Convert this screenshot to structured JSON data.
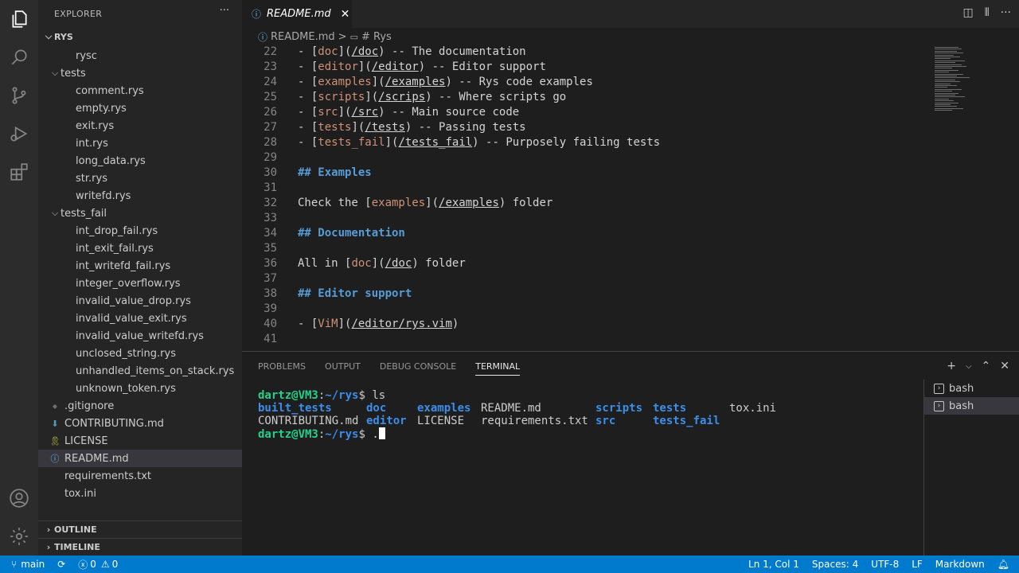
{
  "explorer": {
    "title": "EXPLORER",
    "more": "···",
    "root": "RYS",
    "rows": [
      {
        "label": "rysc",
        "indent": 2,
        "kind": "file",
        "icon": "file"
      },
      {
        "label": "tests",
        "indent": 1,
        "kind": "folder",
        "icon": "folder"
      },
      {
        "label": "comment.rys",
        "indent": 2,
        "kind": "file",
        "icon": "file"
      },
      {
        "label": "empty.rys",
        "indent": 2,
        "kind": "file",
        "icon": "file"
      },
      {
        "label": "exit.rys",
        "indent": 2,
        "kind": "file",
        "icon": "file"
      },
      {
        "label": "int.rys",
        "indent": 2,
        "kind": "file",
        "icon": "file"
      },
      {
        "label": "long_data.rys",
        "indent": 2,
        "kind": "file",
        "icon": "file"
      },
      {
        "label": "str.rys",
        "indent": 2,
        "kind": "file",
        "icon": "file"
      },
      {
        "label": "writefd.rys",
        "indent": 2,
        "kind": "file",
        "icon": "file"
      },
      {
        "label": "tests_fail",
        "indent": 1,
        "kind": "folder",
        "icon": "folder"
      },
      {
        "label": "int_drop_fail.rys",
        "indent": 2,
        "kind": "file",
        "icon": "file"
      },
      {
        "label": "int_exit_fail.rys",
        "indent": 2,
        "kind": "file",
        "icon": "file"
      },
      {
        "label": "int_writefd_fail.rys",
        "indent": 2,
        "kind": "file",
        "icon": "file"
      },
      {
        "label": "integer_overflow.rys",
        "indent": 2,
        "kind": "file",
        "icon": "file"
      },
      {
        "label": "invalid_value_drop.rys",
        "indent": 2,
        "kind": "file",
        "icon": "file"
      },
      {
        "label": "invalid_value_exit.rys",
        "indent": 2,
        "kind": "file",
        "icon": "file"
      },
      {
        "label": "invalid_value_writefd.rys",
        "indent": 2,
        "kind": "file",
        "icon": "file"
      },
      {
        "label": "unclosed_string.rys",
        "indent": 2,
        "kind": "file",
        "icon": "file"
      },
      {
        "label": "unhandled_items_on_stack.rys",
        "indent": 2,
        "kind": "file",
        "icon": "file"
      },
      {
        "label": "unknown_token.rys",
        "indent": 2,
        "kind": "file",
        "icon": "file"
      },
      {
        "label": ".gitignore",
        "indent": 1,
        "kind": "file",
        "icon": "gitignore-icon"
      },
      {
        "label": "CONTRIBUTING.md",
        "indent": 1,
        "kind": "file",
        "icon": "markdown-down-arrow-icon"
      },
      {
        "label": "LICENSE",
        "indent": 1,
        "kind": "file",
        "icon": "license-ribbon-icon"
      },
      {
        "label": "README.md",
        "indent": 1,
        "kind": "file",
        "icon": "info-icon",
        "selected": true
      },
      {
        "label": "requirements.txt",
        "indent": 1,
        "kind": "file",
        "icon": "file"
      },
      {
        "label": "tox.ini",
        "indent": 1,
        "kind": "file",
        "icon": "file"
      }
    ],
    "outline": "OUTLINE",
    "timeline": "TIMELINE"
  },
  "editor": {
    "tab_label": "README.md",
    "breadcrumb": {
      "file": "README.md",
      "separator": ">",
      "symbol": "# Rys"
    },
    "lines": [
      {
        "n": "22",
        "segs": [
          {
            "t": "- [",
            "c": ""
          },
          {
            "t": "doc",
            "c": "lk"
          },
          {
            "t": "](",
            "c": ""
          },
          {
            "t": "/doc",
            "c": "url"
          },
          {
            "t": ") -- The documentation",
            "c": ""
          }
        ]
      },
      {
        "n": "23",
        "segs": [
          {
            "t": "- [",
            "c": ""
          },
          {
            "t": "editor",
            "c": "lk"
          },
          {
            "t": "](",
            "c": ""
          },
          {
            "t": "/editor",
            "c": "url"
          },
          {
            "t": ") -- Editor support",
            "c": ""
          }
        ]
      },
      {
        "n": "24",
        "segs": [
          {
            "t": "- [",
            "c": ""
          },
          {
            "t": "examples",
            "c": "lk"
          },
          {
            "t": "](",
            "c": ""
          },
          {
            "t": "/examples",
            "c": "url"
          },
          {
            "t": ") -- Rys code examples",
            "c": ""
          }
        ]
      },
      {
        "n": "25",
        "segs": [
          {
            "t": "- [",
            "c": ""
          },
          {
            "t": "scripts",
            "c": "lk"
          },
          {
            "t": "](",
            "c": ""
          },
          {
            "t": "/scrips",
            "c": "url"
          },
          {
            "t": ") -- Where scripts go",
            "c": ""
          }
        ]
      },
      {
        "n": "26",
        "segs": [
          {
            "t": "- [",
            "c": ""
          },
          {
            "t": "src",
            "c": "lk"
          },
          {
            "t": "](",
            "c": ""
          },
          {
            "t": "/src",
            "c": "url"
          },
          {
            "t": ") -- Main source code",
            "c": ""
          }
        ]
      },
      {
        "n": "27",
        "segs": [
          {
            "t": "- [",
            "c": ""
          },
          {
            "t": "tests",
            "c": "lk"
          },
          {
            "t": "](",
            "c": ""
          },
          {
            "t": "/tests",
            "c": "url"
          },
          {
            "t": ") -- Passing tests",
            "c": ""
          }
        ]
      },
      {
        "n": "28",
        "segs": [
          {
            "t": "- [",
            "c": ""
          },
          {
            "t": "tests_fail",
            "c": "lk"
          },
          {
            "t": "](",
            "c": ""
          },
          {
            "t": "/tests_fail",
            "c": "url"
          },
          {
            "t": ") -- Purposely failing tests",
            "c": ""
          }
        ]
      },
      {
        "n": "29",
        "segs": []
      },
      {
        "n": "30",
        "segs": [
          {
            "t": "## Examples",
            "c": "hd"
          }
        ]
      },
      {
        "n": "31",
        "segs": []
      },
      {
        "n": "32",
        "segs": [
          {
            "t": "Check the [",
            "c": ""
          },
          {
            "t": "examples",
            "c": "lk"
          },
          {
            "t": "](",
            "c": ""
          },
          {
            "t": "/examples",
            "c": "url"
          },
          {
            "t": ") folder",
            "c": ""
          }
        ]
      },
      {
        "n": "33",
        "segs": []
      },
      {
        "n": "34",
        "segs": [
          {
            "t": "## Documentation",
            "c": "hd"
          }
        ]
      },
      {
        "n": "35",
        "segs": []
      },
      {
        "n": "36",
        "segs": [
          {
            "t": "All in [",
            "c": ""
          },
          {
            "t": "doc",
            "c": "lk"
          },
          {
            "t": "](",
            "c": ""
          },
          {
            "t": "/doc",
            "c": "url"
          },
          {
            "t": ") folder",
            "c": ""
          }
        ]
      },
      {
        "n": "37",
        "segs": []
      },
      {
        "n": "38",
        "segs": [
          {
            "t": "## Editor support",
            "c": "hd"
          }
        ]
      },
      {
        "n": "39",
        "segs": []
      },
      {
        "n": "40",
        "segs": [
          {
            "t": "- [",
            "c": ""
          },
          {
            "t": "ViM",
            "c": "lk"
          },
          {
            "t": "](",
            "c": ""
          },
          {
            "t": "/editor/rys.vim",
            "c": "url"
          },
          {
            "t": ")",
            "c": ""
          }
        ]
      },
      {
        "n": "41",
        "segs": []
      }
    ]
  },
  "panel": {
    "tabs": [
      "PROBLEMS",
      "OUTPUT",
      "DEBUG CONSOLE",
      "TERMINAL"
    ],
    "active_tab": "TERMINAL",
    "terminal": {
      "prompt_user": "dartz@VM3",
      "prompt_path": "~/rys",
      "command": "ls",
      "next_input": ".",
      "ls_rows": [
        [
          {
            "t": "built_tests",
            "dir": true
          },
          {
            "t": "doc",
            "dir": true
          },
          {
            "t": "examples",
            "dir": true
          },
          {
            "t": "README.md",
            "dir": false
          },
          {
            "t": "scripts",
            "dir": true
          },
          {
            "t": "tests",
            "dir": true
          },
          {
            "t": "tox.ini",
            "dir": false
          }
        ],
        [
          {
            "t": "CONTRIBUTING.md",
            "dir": false
          },
          {
            "t": "editor",
            "dir": true
          },
          {
            "t": "LICENSE",
            "dir": false
          },
          {
            "t": "requirements.txt",
            "dir": false
          },
          {
            "t": "src",
            "dir": true
          },
          {
            "t": "tests_fail",
            "dir": true
          },
          {
            "t": "",
            "dir": false
          }
        ]
      ]
    },
    "sessions": [
      "bash",
      "bash"
    ]
  },
  "status": {
    "branch": "main",
    "errors": "0",
    "warnings": "0",
    "position": "Ln 1, Col 1",
    "spaces": "Spaces: 4",
    "encoding": "UTF-8",
    "eol": "LF",
    "language": "Markdown"
  },
  "colors": {
    "accent": "#007acc",
    "link_text": "#ce9178",
    "heading": "#569cd6",
    "terminal_prompt": "#23d18b",
    "terminal_dir": "#3b8eea"
  }
}
